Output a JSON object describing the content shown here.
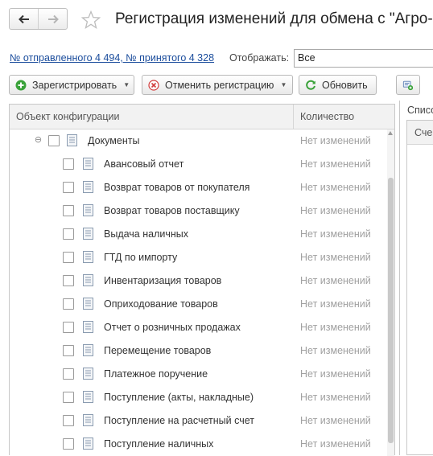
{
  "window": {
    "title": "Регистрация изменений для обмена с  \"Агро-"
  },
  "info": {
    "counts_link": "№ отправленного 4 494, № принятого 4 328",
    "show_label": "Отображать:",
    "show_value": "Все"
  },
  "toolbar": {
    "register_label": "Зарегистрировать",
    "cancel_label": "Отменить регистрацию",
    "refresh_label": "Обновить"
  },
  "table": {
    "columns": [
      "Объект конфигурации",
      "Количество"
    ],
    "group": {
      "name": "Документы",
      "qty": "Нет изменений"
    },
    "rows": [
      {
        "name": "Авансовый отчет",
        "qty": "Нет изменений"
      },
      {
        "name": "Возврат товаров от покупателя",
        "qty": "Нет изменений"
      },
      {
        "name": "Возврат товаров поставщику",
        "qty": "Нет изменений"
      },
      {
        "name": "Выдача наличных",
        "qty": "Нет изменений"
      },
      {
        "name": "ГТД по импорту",
        "qty": "Нет изменений"
      },
      {
        "name": "Инвентаризация товаров",
        "qty": "Нет изменений"
      },
      {
        "name": "Оприходование товаров",
        "qty": "Нет изменений"
      },
      {
        "name": "Отчет о розничных продажах",
        "qty": "Нет изменений"
      },
      {
        "name": "Перемещение товаров",
        "qty": "Нет изменений"
      },
      {
        "name": "Платежное поручение",
        "qty": "Нет изменений"
      },
      {
        "name": "Поступление (акты, накладные)",
        "qty": "Нет изменений"
      },
      {
        "name": "Поступление на расчетный счет",
        "qty": "Нет изменений"
      },
      {
        "name": "Поступление наличных",
        "qty": "Нет изменений"
      }
    ]
  },
  "right_panel": {
    "label": "Списо",
    "header": "Сче"
  },
  "icons": {
    "back": "arrow-left-icon",
    "forward": "arrow-right-icon",
    "favorite": "star-icon",
    "register": "plus-circle-icon",
    "cancel": "cancel-circle-icon",
    "refresh": "refresh-icon",
    "settings": "settings-icon",
    "document": "document-icon",
    "collapse": "collapse-icon"
  },
  "colors": {
    "link": "#1a4c9c",
    "register_green": "#3aa23a",
    "cancel_red": "#d23c3c",
    "refresh_green": "#3aa23a",
    "muted_text": "#a0a0a0"
  }
}
